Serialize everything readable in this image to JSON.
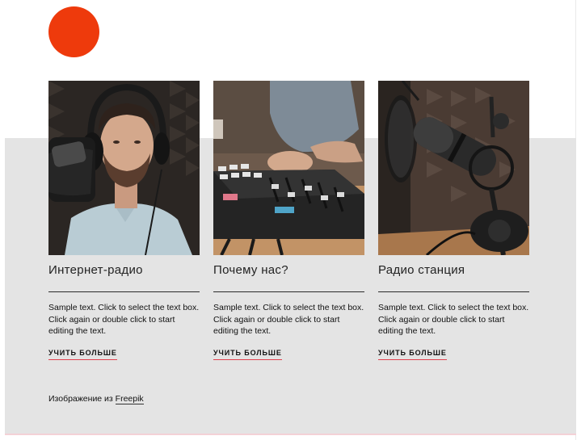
{
  "page": {
    "accent_color": "#ee3a0c",
    "panel_color": "#e4e4e4",
    "link_underline_color": "#e0404e"
  },
  "logo": {
    "shape": "circle",
    "color": "#ee3a0c"
  },
  "cards": [
    {
      "image": "man-with-headphones-and-microphone",
      "title": "Интернет-радио",
      "text": "Sample text. Click to select the text box. Click again or double click to start editing the text.",
      "link_label": "УЧИТЬ БОЛЬШЕ"
    },
    {
      "image": "hands-on-audio-mixer",
      "title": "Почему нас?",
      "text": "Sample text. Click to select the text box. Click again or double click to start editing the text.",
      "link_label": "УЧИТЬ БОЛЬШЕ"
    },
    {
      "image": "studio-condenser-microphone",
      "title": "Радио станция",
      "text": "Sample text. Click to select the text box. Click again or double click to start editing the text.",
      "link_label": "УЧИТЬ БОЛЬШЕ"
    }
  ],
  "credit": {
    "prefix": "Изображение из",
    "link_label": "Freepik"
  }
}
